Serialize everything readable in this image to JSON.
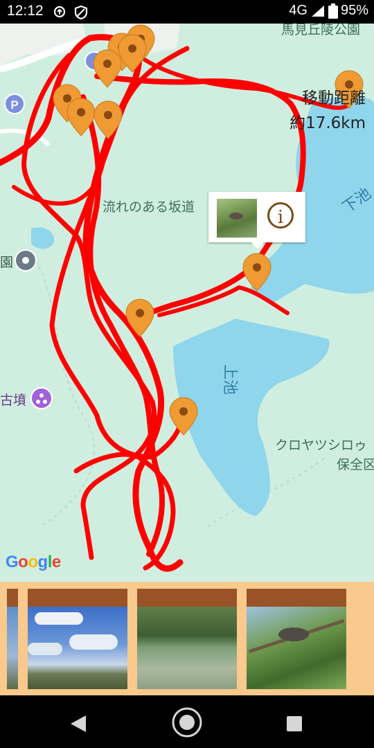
{
  "status_bar": {
    "time": "12:12",
    "network": "4G",
    "battery": "95%"
  },
  "map": {
    "labels": {
      "top_park": "馬見丘陵公園",
      "slope_road": "流れのある坂道",
      "lower_pond": "下池",
      "upper_pond": "上池",
      "kofun": "古墳",
      "park_left": "園",
      "bird_area_1": "クロヤツシロゥ",
      "bird_area_2": "保全区"
    },
    "distance_title": "移動距離",
    "distance_value": "約17.6km",
    "attribution": "Google",
    "colors": {
      "route": "#ff0000",
      "marker": "#ef9a33",
      "land": "#cfeee0",
      "water": "#8fd5ec"
    },
    "marker_count": 11
  },
  "info_window": {
    "icon": "info-icon"
  },
  "photo_strip": {
    "photos": [
      "partial-photo",
      "sky-and-houses-photo",
      "pond-photo",
      "bird-on-branch-photo"
    ]
  },
  "nav_bar": {
    "back": "back-triangle-icon",
    "home": "home-circle-icon",
    "recents": "recents-square-icon"
  }
}
